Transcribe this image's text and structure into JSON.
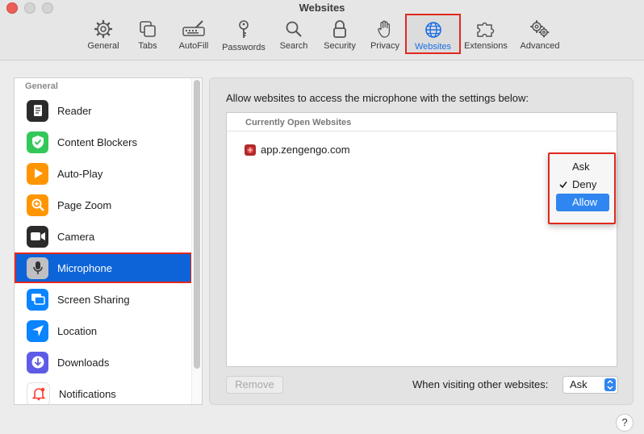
{
  "window": {
    "title": "Websites"
  },
  "toolbar": {
    "items": [
      {
        "label": "General",
        "icon": "gear-icon"
      },
      {
        "label": "Tabs",
        "icon": "tabs-icon"
      },
      {
        "label": "AutoFill",
        "icon": "pencil-keyboard-icon"
      },
      {
        "label": "Passwords",
        "icon": "key-icon"
      },
      {
        "label": "Search",
        "icon": "search-icon"
      },
      {
        "label": "Security",
        "icon": "lock-icon"
      },
      {
        "label": "Privacy",
        "icon": "hand-icon"
      },
      {
        "label": "Websites",
        "icon": "globe-icon"
      },
      {
        "label": "Extensions",
        "icon": "puzzle-icon"
      },
      {
        "label": "Advanced",
        "icon": "gears-icon"
      }
    ],
    "active": "Websites"
  },
  "sidebar": {
    "header": "General",
    "items": [
      {
        "label": "Reader",
        "icon": "reader-icon",
        "color": "#2b2b2b"
      },
      {
        "label": "Content Blockers",
        "icon": "shield-check-icon",
        "color": "#34c759"
      },
      {
        "label": "Auto-Play",
        "icon": "play-icon",
        "color": "#ff9500"
      },
      {
        "label": "Page Zoom",
        "icon": "zoom-icon",
        "color": "#ff9500"
      },
      {
        "label": "Camera",
        "icon": "camera-icon",
        "color": "#2b2b2b"
      },
      {
        "label": "Microphone",
        "icon": "microphone-icon",
        "color": "#8e8e93"
      },
      {
        "label": "Screen Sharing",
        "icon": "screen-sharing-icon",
        "color": "#0a84ff"
      },
      {
        "label": "Location",
        "icon": "location-arrow-icon",
        "color": "#0a84ff"
      },
      {
        "label": "Downloads",
        "icon": "download-icon",
        "color": "#5e5ce6"
      },
      {
        "label": "Notifications",
        "icon": "bell-icon",
        "color": "#ff3b30"
      }
    ],
    "selected": "Microphone"
  },
  "main": {
    "description": "Allow websites to access the microphone with the settings below:",
    "list_header": "Currently Open Websites",
    "websites": [
      {
        "site": "app.zengengo.com",
        "setting": "Deny"
      }
    ],
    "popup_options": [
      "Ask",
      "Deny",
      "Allow"
    ],
    "popup_checked": "Deny",
    "popup_highlighted": "Allow",
    "remove_label": "Remove",
    "other_label": "When visiting other websites:",
    "other_value": "Ask"
  },
  "help_label": "?"
}
